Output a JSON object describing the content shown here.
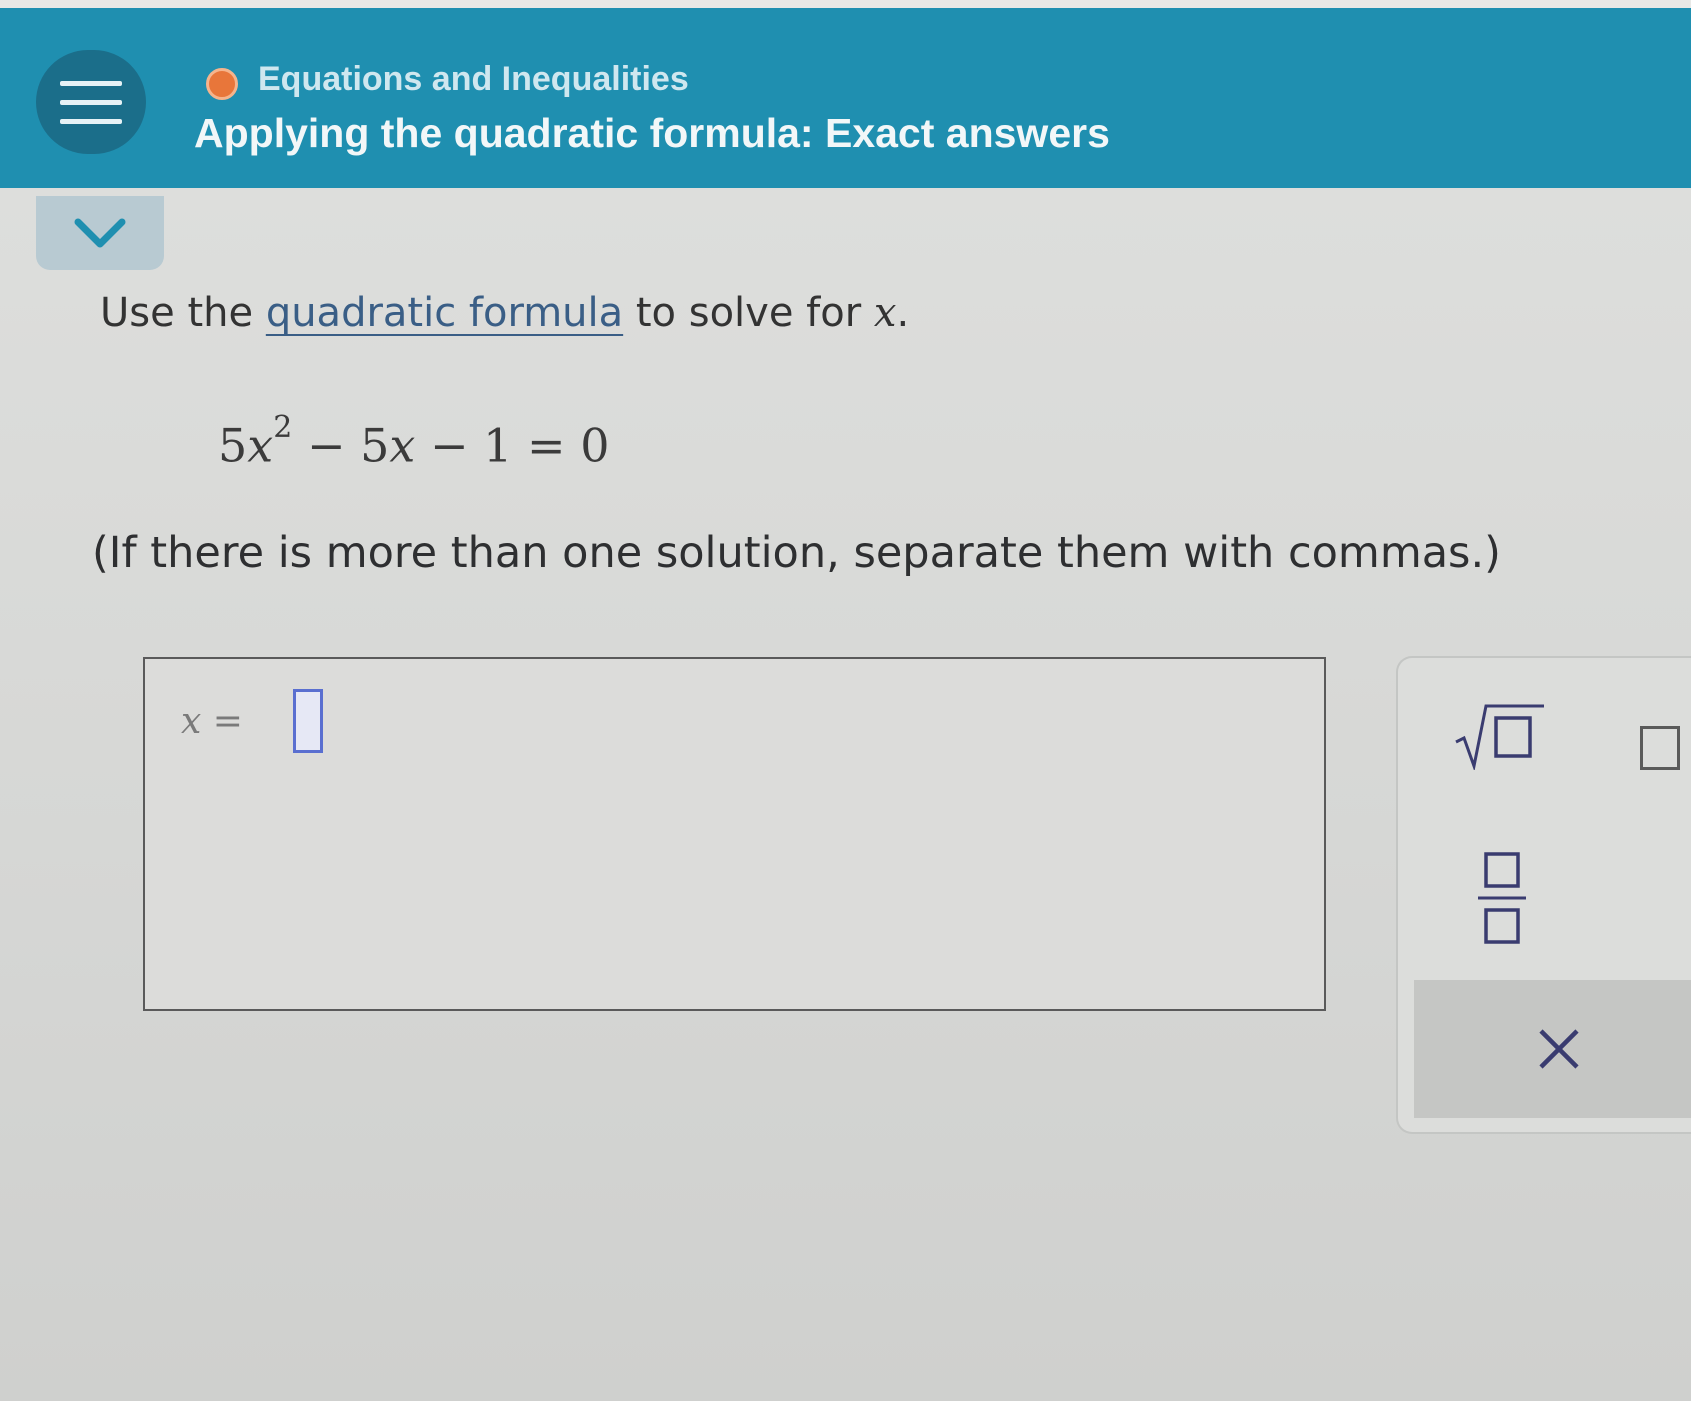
{
  "header": {
    "topic": "Equations and Inequalities",
    "title": "Applying the quadratic formula: Exact answers",
    "topic_dot_color": "#e8763a",
    "background_color": "#1f8fb0",
    "menu_icon": "hamburger-menu-icon",
    "collapse_icon": "chevron-down-icon"
  },
  "problem": {
    "instruction_prefix": "Use the ",
    "instruction_link": "quadratic formula",
    "instruction_suffix": " to solve for ",
    "instruction_var": "x",
    "instruction_end": ".",
    "equation": {
      "coef_a": "5",
      "var": "x",
      "exponent": "2",
      "rest": "− 5",
      "var2": "x",
      "tail": "− 1 = 0"
    },
    "note": "(If there is more than one solution, separate them with commas.)"
  },
  "answer": {
    "lhs_var": "x",
    "lhs_eq": "=",
    "value": ""
  },
  "keypad": {
    "keys": [
      "square-root",
      "exponent",
      "fraction",
      "clear"
    ],
    "clear_label": "×"
  }
}
